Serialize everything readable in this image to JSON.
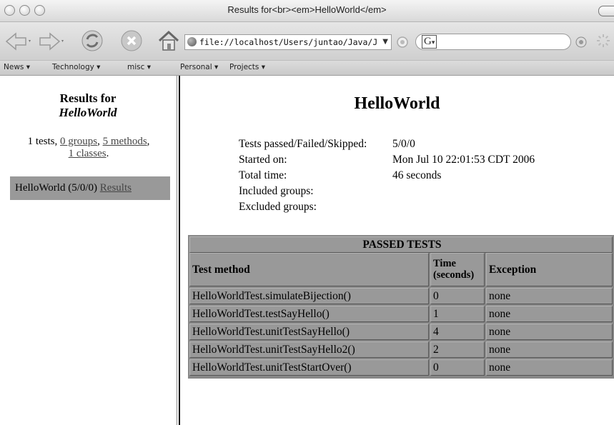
{
  "window": {
    "title": "Results for<br><em>HelloWorld</em>"
  },
  "toolbar": {
    "url": "file://localhost/Users/juntao/Java/J",
    "search_glyph": "G",
    "search_caret": "▾",
    "url_caret": "▼",
    "icons": [
      "back-icon",
      "forward-icon",
      "reload-icon",
      "stop-icon",
      "home-icon",
      "rss-icon",
      "search-submit-icon",
      "activity-spinner-icon"
    ]
  },
  "bookmarks": [
    {
      "label": "News ▾"
    },
    {
      "label": "Technology ▾"
    },
    {
      "label": "misc ▾"
    },
    {
      "label": "Personal ▾"
    },
    {
      "label": "Projects ▾"
    }
  ],
  "sidebar": {
    "title_line1": "Results for",
    "title_line2": "HelloWorld",
    "stats": {
      "tests": "1 tests,",
      "groups": "0 groups",
      "sep1": ",",
      "methods": "5 methods",
      "sep2": ",",
      "classes": "1 classes",
      "end": "."
    },
    "suite": {
      "name": "HelloWorld (5/0/0)",
      "link": "Results"
    }
  },
  "main": {
    "heading": "HelloWorld",
    "info": {
      "passed_label": "Tests passed/Failed/Skipped:",
      "passed_value": "5/0/0",
      "started_label": "Started on:",
      "started_value": "Mon Jul 10 22:01:53 CDT 2006",
      "total_label": "Total time:",
      "total_value": "46 seconds",
      "included_label": "Included groups:",
      "excluded_label": "Excluded groups:"
    },
    "table": {
      "caption": "PASSED TESTS",
      "headers": {
        "method": "Test method",
        "time_1": "Time",
        "time_2": "(seconds)",
        "exception": "Exception"
      },
      "rows": [
        {
          "method": "HelloWorldTest.simulateBijection()",
          "time": "0",
          "exception": "none"
        },
        {
          "method": "HelloWorldTest.testSayHello()",
          "time": "1",
          "exception": "none"
        },
        {
          "method": "HelloWorldTest.unitTestSayHello()",
          "time": "4",
          "exception": "none"
        },
        {
          "method": "HelloWorldTest.unitTestSayHello2()",
          "time": "2",
          "exception": "none"
        },
        {
          "method": "HelloWorldTest.unitTestStartOver()",
          "time": "0",
          "exception": "none"
        }
      ]
    }
  }
}
